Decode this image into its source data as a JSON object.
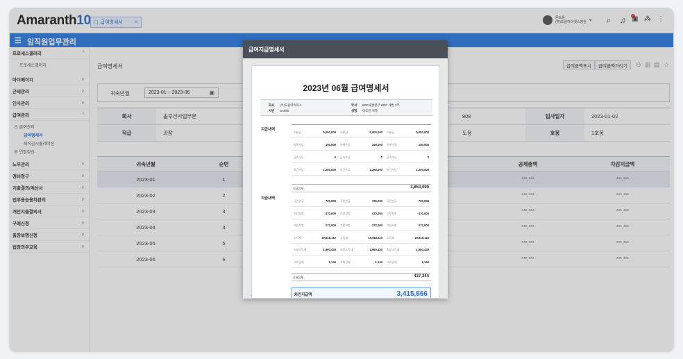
{
  "app": {
    "logo_text": "Amaranth",
    "logo_num": "10"
  },
  "tab": {
    "label": "급여명세서",
    "close": "✕"
  },
  "user": {
    "line1": "문도윤",
    "line2": "(주)도원아이넷스정원"
  },
  "menubar": {
    "title": "임직원업무관리"
  },
  "sidebar": {
    "items": [
      {
        "label": "프로세스갤러리",
        "expanded": true
      },
      {
        "label": "마이페이지"
      },
      {
        "label": "근태관리"
      },
      {
        "label": "인사관리"
      },
      {
        "label": "급여관리",
        "expanded": true
      },
      {
        "label": "노무관리"
      },
      {
        "label": "경비청구"
      },
      {
        "label": "지출결의/계산서"
      },
      {
        "label": "업무용승용차관리"
      },
      {
        "label": "개인지출결의서"
      },
      {
        "label": "구매신청"
      },
      {
        "label": "출장보명신청"
      },
      {
        "label": "법정의무교육"
      }
    ],
    "sub_process": "프로세스갤러리",
    "sub_pay": "급여관리",
    "sub_pay_active": "급여명세서",
    "sub_pay2": "퇴직금시뮬레이션",
    "sub_pay3": "연말정산"
  },
  "page": {
    "title": "급여명세서",
    "btn1": "급여금액표시",
    "btn2": "급여금액가리기"
  },
  "filter": {
    "label": "귀속년월",
    "value": "2023-01 ~ 2023-06"
  },
  "info": {
    "company_label": "회사",
    "company_value": "솔루션사업부문",
    "hire_label": "입사일자",
    "hire_value": "2023-01-02",
    "hidden_1": "808",
    "position_label": "직급",
    "position_value": "과장",
    "step_label": "호봉",
    "step_value": "1호봉",
    "hidden_2": "도용"
  },
  "grid": {
    "headers": [
      "귀속년월",
      "순번",
      "공제총액",
      "차감지급액"
    ],
    "rows": [
      {
        "month": "2023-01",
        "seq": "1",
        "deduct": "***,***",
        "net": "***,***"
      },
      {
        "month": "2023-02",
        "seq": "2",
        "deduct": "***,***",
        "net": "***,***"
      },
      {
        "month": "2023-03",
        "seq": "3",
        "deduct": "***,***",
        "net": "***,***"
      },
      {
        "month": "2023-04",
        "seq": "4",
        "deduct": "***,***",
        "net": "***,***"
      },
      {
        "month": "2023-05",
        "seq": "5",
        "deduct": "***,***",
        "net": "***,***"
      },
      {
        "month": "2023-06",
        "seq": "6",
        "deduct": "***,***",
        "net": "***,***"
      }
    ]
  },
  "modal": {
    "header": "급여지급명세서",
    "doc_title": "2023년 06월 급여명세서",
    "company_key": "회사",
    "company_val": "(주)도원아이피스",
    "emp_key": "사번",
    "emp_val": "D4885",
    "dept_key": "부서",
    "dept_val": "ERP개발본부 ERP 개발 2부",
    "name_key": "성명",
    "name_val": "이도윤 귀하",
    "pay_section": "지급내역",
    "ded_section": "지급내역",
    "pay_rows": [
      {
        "label": "기본급",
        "value": "5,000,000"
      },
      {
        "label": "직책수당",
        "value": "150,000"
      },
      {
        "label": "근속수당",
        "value": "0"
      },
      {
        "label": "야간수당",
        "value": "1,250,000"
      }
    ],
    "pay_total_label": "지급합계",
    "pay_total": "3,853,000",
    "ded_rows": [
      {
        "label": "국민연금",
        "value": "705,000"
      },
      {
        "label": "건강보험",
        "value": "470,000"
      },
      {
        "label": "고용보험",
        "value": "272,000"
      },
      {
        "label": "소득세",
        "value": "19,618,110"
      },
      {
        "label": "지방소득세",
        "value": "1,960,430"
      },
      {
        "label": "그외공제",
        "value": "1,144"
      }
    ],
    "ded_total_label": "공제합계",
    "ded_total": "437,344",
    "net_label": "차인지급액",
    "net_value": "3,415,666"
  },
  "colors": {
    "accent": "#2c7be5",
    "modal_header": "#4a4f58",
    "selected_row": "#e6ebf3"
  },
  "icons": [
    "hamburger-icon",
    "search-icon",
    "bell-icon",
    "calendar-icon",
    "grid-icon",
    "more-icon",
    "chevron-down-icon",
    "print-icon",
    "star-icon"
  ]
}
